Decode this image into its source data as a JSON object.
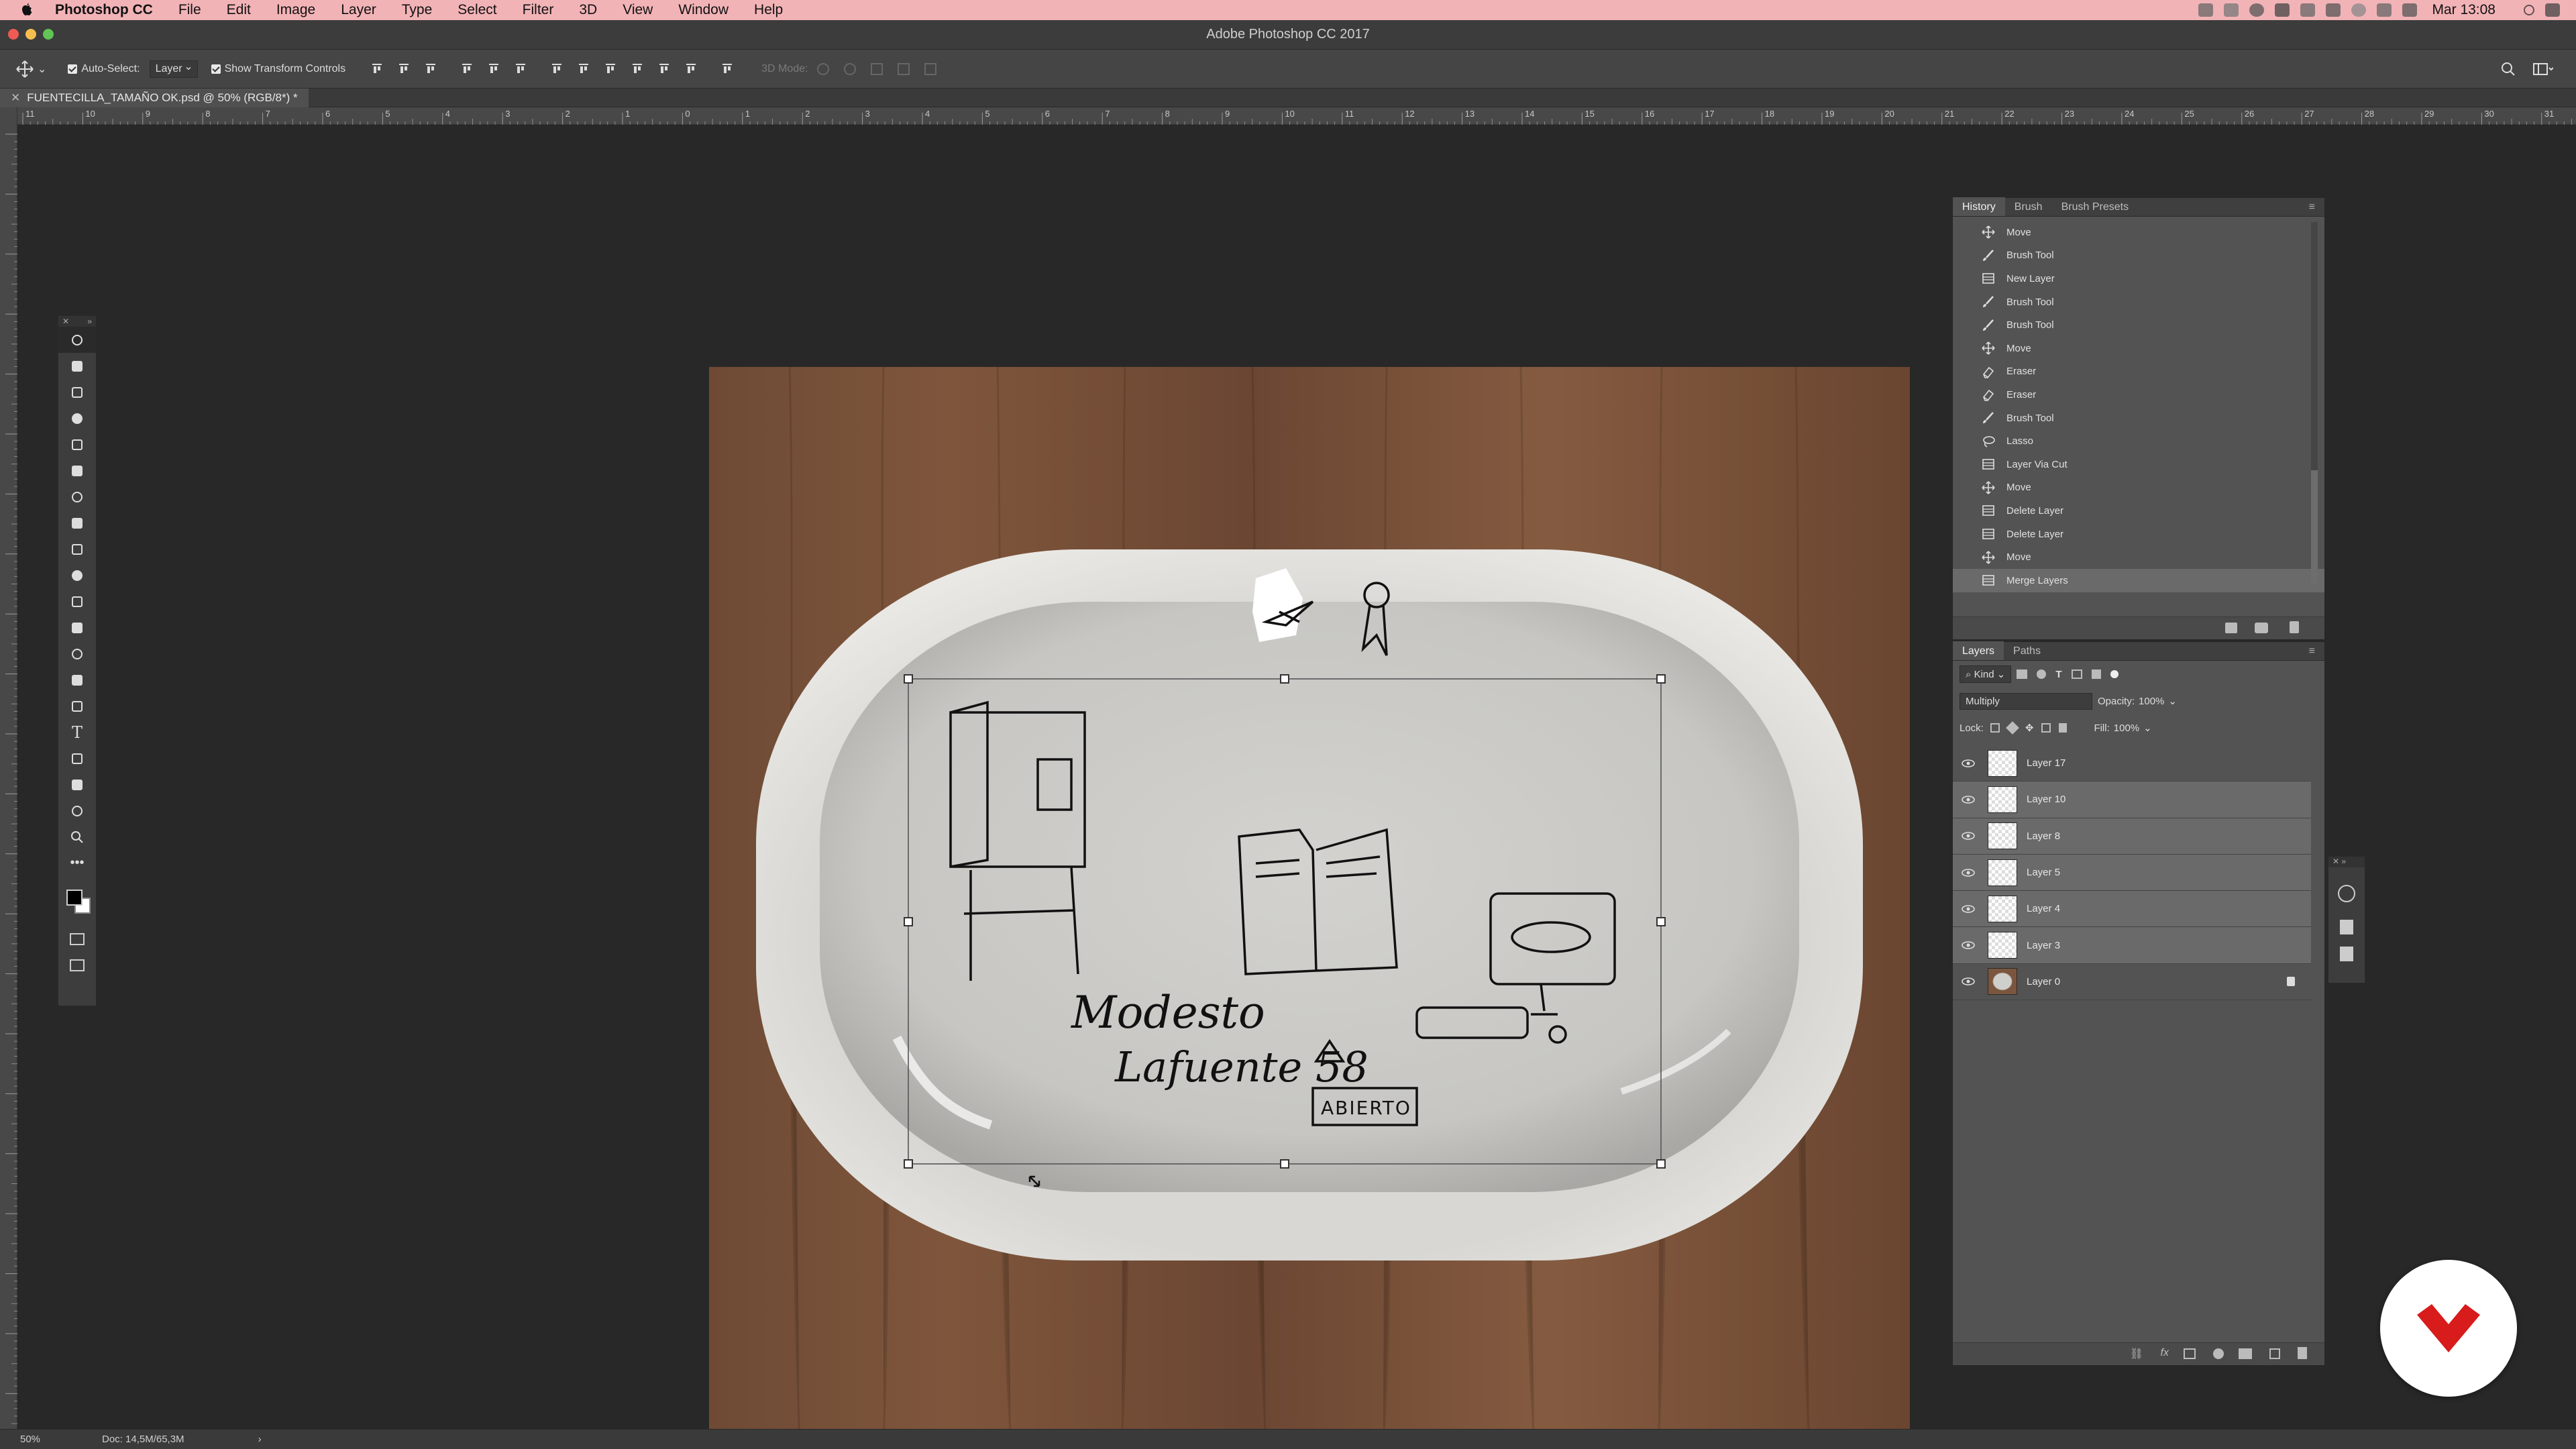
{
  "menubar": {
    "app_name": "Photoshop CC",
    "items": [
      "File",
      "Edit",
      "Image",
      "Layer",
      "Type",
      "Select",
      "Filter",
      "3D",
      "View",
      "Window",
      "Help"
    ],
    "clock": "Mar 13:08"
  },
  "window": {
    "title": "Adobe Photoshop CC 2017"
  },
  "options": {
    "auto_select_label": "Auto-Select:",
    "auto_select_target": "Layer",
    "transform_label": "Show Transform Controls",
    "mode_3d_label": "3D Mode:"
  },
  "document": {
    "tab_title": "FUENTECILLA_TAMAÑO OK.psd @ 50% (RGB/8*) *"
  },
  "ruler": {
    "h_ticks": [
      "11",
      "10",
      "9",
      "8",
      "7",
      "6",
      "5",
      "4",
      "3",
      "2",
      "1",
      "0",
      "1",
      "2",
      "3",
      "4",
      "5",
      "6",
      "7",
      "8",
      "9",
      "10",
      "11",
      "12",
      "13",
      "14",
      "15",
      "16",
      "17",
      "18",
      "19",
      "20",
      "21",
      "22",
      "23",
      "24",
      "25",
      "26",
      "27",
      "28",
      "29",
      "30",
      "31"
    ]
  },
  "artwork": {
    "line1": "Modesto",
    "line2": "Lafuente 58",
    "sign": "ABIERTO"
  },
  "history_panel": {
    "tabs": [
      "History",
      "Brush",
      "Brush Presets"
    ],
    "active_tab": "History",
    "items": [
      {
        "label": "Move",
        "icon": "move-icon"
      },
      {
        "label": "Brush Tool",
        "icon": "brush-icon"
      },
      {
        "label": "New Layer",
        "icon": "layer-icon"
      },
      {
        "label": "Brush Tool",
        "icon": "brush-icon"
      },
      {
        "label": "Brush Tool",
        "icon": "brush-icon"
      },
      {
        "label": "Move",
        "icon": "move-icon"
      },
      {
        "label": "Eraser",
        "icon": "eraser-icon"
      },
      {
        "label": "Eraser",
        "icon": "eraser-icon"
      },
      {
        "label": "Brush Tool",
        "icon": "brush-icon"
      },
      {
        "label": "Lasso",
        "icon": "lasso-icon"
      },
      {
        "label": "Layer Via Cut",
        "icon": "layer-icon"
      },
      {
        "label": "Move",
        "icon": "move-icon"
      },
      {
        "label": "Delete Layer",
        "icon": "layer-icon"
      },
      {
        "label": "Delete Layer",
        "icon": "layer-icon"
      },
      {
        "label": "Move",
        "icon": "move-icon"
      },
      {
        "label": "Merge Layers",
        "icon": "layer-icon"
      }
    ],
    "selected_index": 15
  },
  "layers_panel": {
    "tabs": [
      "Layers",
      "Paths"
    ],
    "active_tab": "Layers",
    "filter_label": "Kind",
    "blend_mode": "Multiply",
    "opacity_label": "Opacity:",
    "opacity_value": "100%",
    "lock_label": "Lock:",
    "fill_label": "Fill:",
    "fill_value": "100%",
    "layers": [
      {
        "name": "Layer 17",
        "selected": false,
        "locked": false
      },
      {
        "name": "Layer 10",
        "selected": true,
        "locked": false
      },
      {
        "name": "Layer 8",
        "selected": true,
        "locked": false
      },
      {
        "name": "Layer 5",
        "selected": true,
        "locked": false
      },
      {
        "name": "Layer 4",
        "selected": true,
        "locked": false
      },
      {
        "name": "Layer 3",
        "selected": true,
        "locked": false
      },
      {
        "name": "Layer 0",
        "selected": false,
        "locked": true
      }
    ]
  },
  "status": {
    "zoom": "50%",
    "doc_size": "Doc: 14,5M/65,3M"
  },
  "colors": {
    "accent": "#d81b1b",
    "menubar_bg": "#f2b3b7",
    "panel_bg": "#535353",
    "canvas_bg": "#282828"
  }
}
